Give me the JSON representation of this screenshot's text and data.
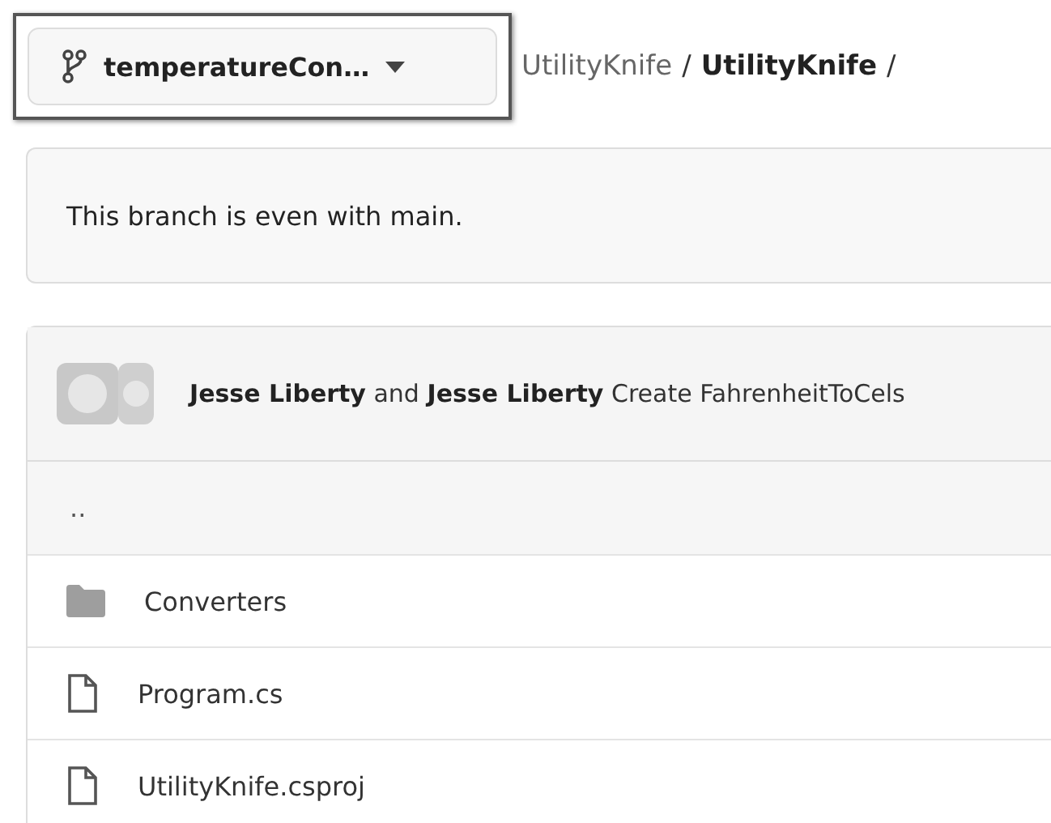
{
  "branch_button": {
    "label": "temperatureCon…"
  },
  "breadcrumb": [
    {
      "label": "UtilityKnife",
      "current": false,
      "separator": "/"
    },
    {
      "label": "UtilityKnife",
      "current": true,
      "separator": "/"
    }
  ],
  "notice": "This branch is even with main.",
  "commit": {
    "text": "**Jesse Liberty** and **Jesse Liberty** Create FahrenheitToCels"
  },
  "parent_link": "..",
  "files": [
    {
      "kind": "folder",
      "name": "Converters"
    },
    {
      "kind": "file",
      "name": "Program.cs"
    },
    {
      "kind": "file",
      "name": "UtilityKnife.csproj"
    }
  ]
}
